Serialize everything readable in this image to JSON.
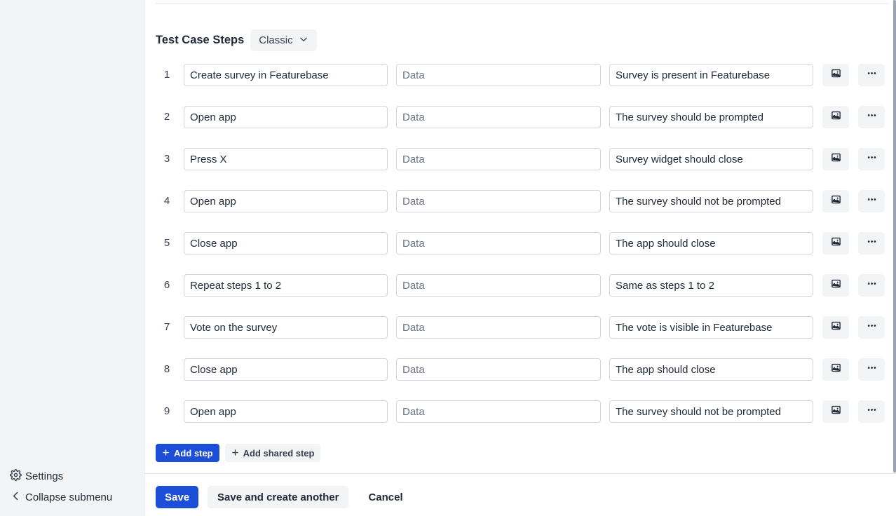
{
  "sidebar": {
    "settings_label": "Settings",
    "settings_icon": "gear-icon",
    "collapse_label": "Collapse submenu",
    "collapse_icon": "chevron-left-icon"
  },
  "section": {
    "title": "Test Case Steps",
    "mode_label": "Classic"
  },
  "steps": [
    {
      "number": "1",
      "action": "Create survey in Featurebase",
      "data_placeholder": "Data",
      "result": "Survey is present in Featurebase"
    },
    {
      "number": "2",
      "action": "Open app",
      "data_placeholder": "Data",
      "result": "The survey should be prompted"
    },
    {
      "number": "3",
      "action": "Press X",
      "data_placeholder": "Data",
      "result": "Survey widget should close"
    },
    {
      "number": "4",
      "action": "Open app",
      "data_placeholder": "Data",
      "result": "The survey should not be prompted"
    },
    {
      "number": "5",
      "action": "Close app",
      "data_placeholder": "Data",
      "result": "The app should close"
    },
    {
      "number": "6",
      "action": "Repeat steps 1 to 2",
      "data_placeholder": "Data",
      "result": "Same as steps 1 to 2"
    },
    {
      "number": "7",
      "action": "Vote on the survey",
      "data_placeholder": "Data",
      "result": "The vote is visible in Featurebase"
    },
    {
      "number": "8",
      "action": "Close app",
      "data_placeholder": "Data",
      "result": "The app should close"
    },
    {
      "number": "9",
      "action": "Open app",
      "data_placeholder": "Data",
      "result": "The survey should not be prompted"
    }
  ],
  "add": {
    "add_step_label": "Add step",
    "add_shared_step_label": "Add shared step"
  },
  "footer": {
    "save_label": "Save",
    "save_another_label": "Save and create another",
    "cancel_label": "Cancel"
  },
  "colors": {
    "primary": "#1d4ed8",
    "sidebar_bg": "#f3f4f6",
    "button_bg": "#f3f4f6"
  }
}
